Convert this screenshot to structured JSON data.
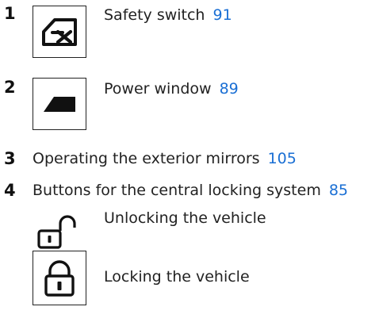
{
  "items": [
    {
      "number": "1",
      "text": "Safety switch",
      "page_ref": "91",
      "icon": "window-lock-icon"
    },
    {
      "number": "2",
      "text": "Power window",
      "page_ref": "89",
      "icon": "power-window-icon"
    },
    {
      "number": "3",
      "text": "Operating the exterior mirrors",
      "page_ref": "105"
    },
    {
      "number": "4",
      "text": "Buttons for the central locking system",
      "page_ref": "85",
      "sub_items": [
        {
          "text": "Unlocking the vehicle",
          "icon": "padlock-open-icon"
        },
        {
          "text": "Locking the vehicle",
          "icon": "padlock-closed-icon"
        }
      ]
    }
  ],
  "colors": {
    "link": "#1a6fd4",
    "text": "#222222"
  }
}
